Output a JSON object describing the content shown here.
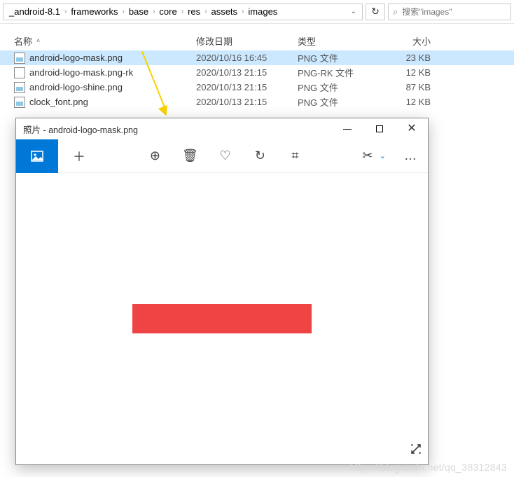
{
  "breadcrumb": {
    "segments": [
      "_android-8.1",
      "frameworks",
      "base",
      "core",
      "res",
      "assets",
      "images"
    ]
  },
  "toolbar": {
    "refresh_glyph": "↻"
  },
  "search": {
    "icon": "⌕",
    "placeholder": "搜索\"images\""
  },
  "headers": {
    "name": "名称",
    "date": "修改日期",
    "type": "类型",
    "size": "大小"
  },
  "files": [
    {
      "name": "android-logo-mask.png",
      "date": "2020/10/16 16:45",
      "type": "PNG 文件",
      "size": "23 KB",
      "icon": "img",
      "selected": true
    },
    {
      "name": "android-logo-mask.png-rk",
      "date": "2020/10/13 21:15",
      "type": "PNG-RK 文件",
      "size": "12 KB",
      "icon": "blank",
      "selected": false
    },
    {
      "name": "android-logo-shine.png",
      "date": "2020/10/13 21:15",
      "type": "PNG 文件",
      "size": "87 KB",
      "icon": "img",
      "selected": false
    },
    {
      "name": "clock_font.png",
      "date": "2020/10/13 21:15",
      "type": "PNG 文件",
      "size": "12 KB",
      "icon": "img",
      "selected": false
    }
  ],
  "preview": {
    "title": "照片 - android-logo-mask.png",
    "tools": {
      "view": "▢",
      "add": "＋",
      "zoom": "⊕",
      "delete": "🗑",
      "heart": "♡",
      "rotate": "↻",
      "crop": "⌗",
      "cut": "✂",
      "more": "…"
    },
    "resize_glyph": "↘"
  },
  "watermark": "https://blog.csdn.net/qq_38312843"
}
